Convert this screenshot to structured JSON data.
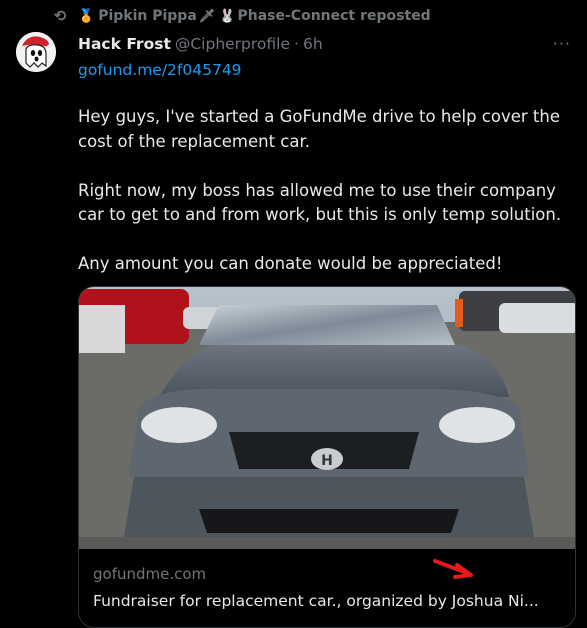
{
  "repost": {
    "user": "Pipkin Pippa",
    "reposter": "Phase-Connect",
    "action": "reposted",
    "icons": [
      "repost-icon",
      "medal-icon",
      "sword-icon",
      "rabbit-icon"
    ]
  },
  "tweet": {
    "display_name": "Hack Frost",
    "handle": "@Cipherprofile",
    "separator": "·",
    "time": "6h",
    "link": "gofund.me/2f045749",
    "paragraphs": [
      "Hey guys, I've started a GoFundMe drive to help cover the cost of the replacement car.",
      "Right now, my boss has allowed me to use their company car to get to and from work, but this is only temp solution.",
      "Any amount you can donate would be appreciated!"
    ],
    "more": "···"
  },
  "card": {
    "domain": "gofundme.com",
    "title": "Fundraiser for replacement car., organized by Joshua Ni..."
  },
  "colors": {
    "background": "#000000",
    "text": "#e7e9ea",
    "muted": "#71767b",
    "link": "#1d9bf0",
    "border": "#2f3336"
  }
}
